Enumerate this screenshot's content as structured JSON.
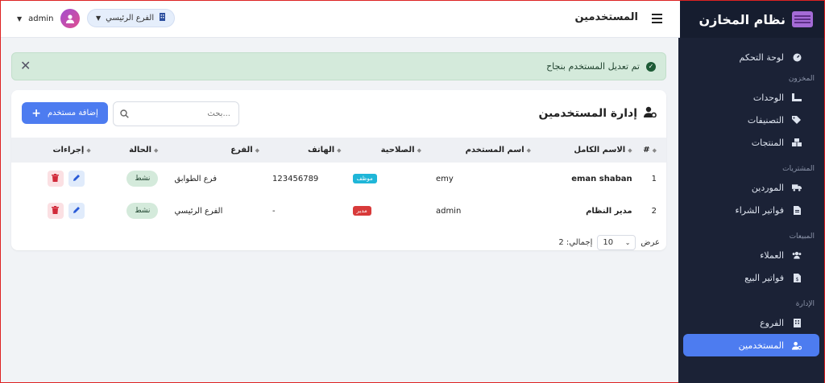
{
  "sidebar": {
    "brand": "نظام المخازن",
    "items": [
      {
        "type": "item",
        "label": "لوحة التحكم",
        "icon": "dashboard-icon"
      },
      {
        "type": "section",
        "label": "المخزون"
      },
      {
        "type": "item",
        "label": "الوحدات",
        "icon": "ruler-icon"
      },
      {
        "type": "item",
        "label": "التصنيفات",
        "icon": "tags-icon"
      },
      {
        "type": "item",
        "label": "المنتجات",
        "icon": "boxes-icon"
      },
      {
        "type": "section",
        "label": "المشتريات"
      },
      {
        "type": "item",
        "label": "الموردين",
        "icon": "truck-icon"
      },
      {
        "type": "item",
        "label": "فواتير الشراء",
        "icon": "invoice-icon"
      },
      {
        "type": "section",
        "label": "المبيعات"
      },
      {
        "type": "item",
        "label": "العملاء",
        "icon": "users-icon"
      },
      {
        "type": "item",
        "label": "فواتير البيع",
        "icon": "invoice-dollar-icon"
      },
      {
        "type": "section",
        "label": "الإدارة"
      },
      {
        "type": "item",
        "label": "الفروع",
        "icon": "building-icon"
      },
      {
        "type": "item",
        "label": "المستخدمين",
        "icon": "user-gear-icon",
        "active": true
      }
    ]
  },
  "topbar": {
    "page_name": "المستخدمين",
    "branch": "الفرع الرئيسي",
    "username": "admin"
  },
  "alert": {
    "message": "تم تعديل المستخدم بنجاح",
    "color": "#d4eadb"
  },
  "card": {
    "title": "إدارة المستخدمين",
    "search_placeholder": "بحث...",
    "add_button": "إضافة مستخدم"
  },
  "table": {
    "columns": [
      "#",
      "الاسم الكامل",
      "اسم المستخدم",
      "الصلاحية",
      "الهاتف",
      "الفرع",
      "الحالة",
      "إجراءات"
    ],
    "rows": [
      {
        "num": "1",
        "full_name": "eman shaban",
        "username": "emy",
        "role": "موظف",
        "role_color": "#1fb6d8",
        "phone": "123456789",
        "branch": "فرع الطوابق",
        "status": "نشط"
      },
      {
        "num": "2",
        "full_name": "مدير النظام",
        "username": "admin",
        "role": "مدير",
        "role_color": "#d83a3a",
        "phone": "-",
        "branch": "الفرع الرئيسي",
        "status": "نشط"
      }
    ]
  },
  "pagination": {
    "show_label": "عرض",
    "per_page": "10",
    "total_label": "إجمالي: 2"
  },
  "colors": {
    "sidebar_bg": "#1b2236",
    "accent": "#4d7cf0"
  }
}
